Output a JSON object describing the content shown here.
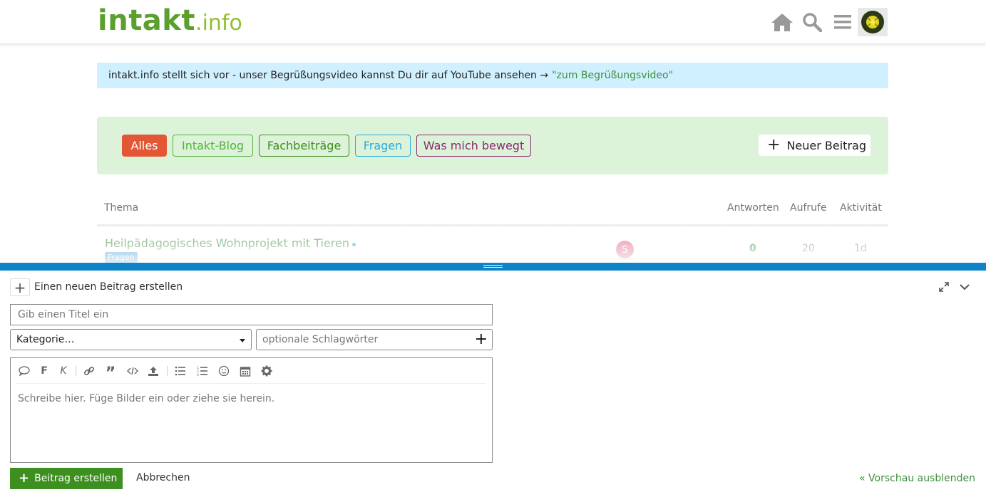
{
  "header": {
    "logo_main": "intakt",
    "logo_tld": ".info",
    "icons": [
      "home-icon",
      "search-icon",
      "hamburger-icon",
      "user-avatar"
    ]
  },
  "banner": {
    "text": "intakt.info stellt sich vor - unser Begrüßungsvideo kannst Du dir auf YouTube ansehen →",
    "link": "\"zum Begrüßungsvideo\""
  },
  "categories": {
    "items": [
      {
        "label": "Alles",
        "color": "#e45735",
        "active": true
      },
      {
        "label": "Intakt-Blog",
        "color": "#56b141"
      },
      {
        "label": "Fachbeiträge",
        "color": "#3d8f1f"
      },
      {
        "label": "Fragen",
        "color": "#25aae1"
      },
      {
        "label": "Was mich bewegt",
        "color": "#8c2a6f"
      }
    ],
    "new_post_label": "Neuer Beitrag"
  },
  "topic_list": {
    "headers": {
      "topic": "Thema",
      "replies": "Antworten",
      "views": "Aufrufe",
      "activity": "Aktivität"
    },
    "rows": [
      {
        "title": "Heilpädagogisches Wohnprojekt mit Tieren",
        "tag": "Fragen",
        "poster_initial": "S",
        "replies": "0",
        "views": "20",
        "activity": "1d"
      }
    ]
  },
  "composer": {
    "title": "Einen neuen Beitrag erstellen",
    "title_placeholder": "Gib einen Titel ein",
    "category_placeholder": "Kategorie…",
    "tags_placeholder": "optionale Schlagwörter",
    "editor_placeholder": "Schreibe hier. Füge Bilder ein oder ziehe sie herein.",
    "toolbar": {
      "bold": "F",
      "italic": "K"
    },
    "create_label": "Beitrag erstellen",
    "cancel_label": "Abbrechen",
    "preview_toggle_label": "« Vorschau ausblenden"
  },
  "colors": {
    "accent_green": "#3d8f1f",
    "link_green": "#3d8f3d",
    "composer_bar": "#0f83c7",
    "banner_bg": "#d1f0ff",
    "category_bar_bg": "#dcf3da"
  }
}
